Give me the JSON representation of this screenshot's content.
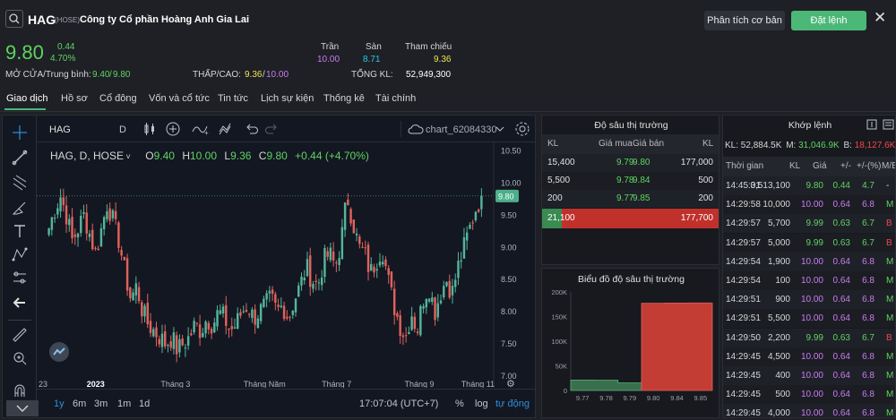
{
  "header": {
    "symbol": "HAG",
    "exchange": "(HOSE)",
    "company": "Công ty Cổ phần Hoàng Anh Gia Lai",
    "btn_analysis": "Phân tích cơ bản",
    "btn_order": "Đặt lệnh",
    "price": "9.80",
    "change": "0.44",
    "change_pct": "4.70%",
    "open_avg_label": "MỞ CỬA/Trung bình:",
    "open": "9.40",
    "avg": "9.80",
    "ceil_label": "Trần",
    "ceil": "10.00",
    "floor_label": "Sàn",
    "floor": "8.71",
    "ref_label": "Tham chiếu",
    "ref": "9.36",
    "lowhigh_label": "THẤP/CAO:",
    "low": "9.36",
    "high": "10.00",
    "vol_label": "TỔNG KL:",
    "vol": "52,949,300"
  },
  "tabs": [
    "Giao dịch",
    "Hồ sơ",
    "Cổ đông",
    "Vốn và cổ tức",
    "Tin tức",
    "Lịch sự kiện",
    "Thống kê",
    "Tài chính"
  ],
  "chart": {
    "symbol_box": "HAG",
    "interval": "D",
    "layout_name": "chart_62084330",
    "legend_title": "HAG, D, HOSE",
    "o_label": "O",
    "o": "9.40",
    "h_label": "H",
    "h": "10.00",
    "l_label": "L",
    "l": "9.36",
    "c_label": "C",
    "c": "9.80",
    "chg": "+0.44 (+4.70%)",
    "last_price_tag": "9.80",
    "time": "17:07:04 (UTC+7)",
    "ranges": [
      "1y",
      "6m",
      "3m",
      "1m",
      "1d"
    ],
    "pct": "%",
    "log": "log",
    "auto": "tự động"
  },
  "chart_data": {
    "type": "candlestick",
    "title": "HAG, D, HOSE",
    "y_ticks": [
      10.5,
      10.0,
      9.5,
      9.0,
      8.5,
      8.0,
      7.5,
      7.0
    ],
    "y_tick_labels": [
      "10.50",
      "10.00",
      "9.50",
      "9.00",
      "8.50",
      "8.00",
      "7.50",
      "7.00"
    ],
    "ylim": [
      6.9,
      10.55
    ],
    "x_tick_labels": [
      "23",
      "2023",
      "Tháng 3",
      "Tháng Năm",
      "Tháng 7",
      "Tháng 9",
      "Tháng 11"
    ],
    "close_path": [
      9.3,
      9.6,
      9.8,
      9.5,
      9.1,
      9.3,
      9.5,
      9.2,
      8.9,
      9.3,
      9.7,
      9.4,
      9.1,
      8.6,
      8.2,
      8.4,
      8.0,
      7.8,
      7.7,
      7.6,
      7.5,
      7.6,
      7.4,
      7.5,
      7.6,
      7.8,
      7.7,
      7.9,
      7.8,
      8.0,
      7.9,
      7.7,
      7.8,
      8.0,
      8.1,
      7.9,
      8.0,
      8.1,
      8.2,
      8.0,
      8.1,
      7.9,
      8.2,
      8.4,
      8.7,
      8.5,
      8.4,
      8.8,
      8.9,
      8.7,
      9.1,
      9.8,
      9.4,
      9.0,
      8.9,
      8.6,
      8.8,
      9.0,
      8.5,
      8.1,
      7.8,
      7.6,
      8.0,
      7.7,
      8.2,
      8.4,
      8.0,
      8.3,
      8.5,
      8.3,
      8.7,
      9.0,
      9.3,
      9.6,
      9.8
    ],
    "last_close": 9.8,
    "x_ticks_at": [
      0.0,
      0.09,
      0.26,
      0.45,
      0.63,
      0.82,
      0.95
    ]
  },
  "depth": {
    "title": "Độ sâu thị trường",
    "headers": [
      "KL",
      "Giá mua",
      "Giá bán",
      "KL"
    ],
    "rows": [
      {
        "bid_vol": "15,400",
        "bid": "9.79",
        "ask": "9.80",
        "ask_vol": "177,000"
      },
      {
        "bid_vol": "5,500",
        "bid": "9.78",
        "ask": "9.84",
        "ask_vol": "500"
      },
      {
        "bid_vol": "200",
        "bid": "9.77",
        "ask": "9.85",
        "ask_vol": "200"
      }
    ],
    "total_bid": "21,100",
    "total_ask": "177,700",
    "bid_fraction": 0.11
  },
  "depth_chart": {
    "title": "Biểu đồ độ sâu thị trường",
    "y_labels": [
      "200K",
      "150K",
      "100K",
      "50K",
      "0"
    ],
    "x_labels": [
      "9.77",
      "9.78",
      "9.79",
      "9.80",
      "9.84",
      "9.85"
    ],
    "bid_cum": [
      21100,
      20900,
      15400
    ],
    "ask_cum": [
      177000,
      177500,
      177700
    ],
    "ymax": 200000
  },
  "matches": {
    "title": "Khớp lệnh",
    "summary_kl_label": "KL:",
    "summary_kl": "52,884.5K",
    "m_label": "M:",
    "m": "31,046.9K",
    "b_label": "B:",
    "b": "18,127.6K",
    "headers": [
      "Thời gian",
      "KL",
      "Giá",
      "+/-",
      "+/-(%)",
      "M/B"
    ],
    "rows": [
      {
        "t": "14:45:01",
        "kl": "3,513,100",
        "p": "9.80",
        "d": "0.44",
        "pct": "4.7",
        "mb": "-",
        "color": "green"
      },
      {
        "t": "14:29:58",
        "kl": "10,000",
        "p": "10.00",
        "d": "0.64",
        "pct": "6.8",
        "mb": "M",
        "color": "purple"
      },
      {
        "t": "14:29:57",
        "kl": "5,700",
        "p": "9.99",
        "d": "0.63",
        "pct": "6.7",
        "mb": "B",
        "color": "green"
      },
      {
        "t": "14:29:57",
        "kl": "5,000",
        "p": "9.99",
        "d": "0.63",
        "pct": "6.7",
        "mb": "B",
        "color": "green"
      },
      {
        "t": "14:29:54",
        "kl": "1,900",
        "p": "10.00",
        "d": "0.64",
        "pct": "6.8",
        "mb": "M",
        "color": "purple"
      },
      {
        "t": "14:29:54",
        "kl": "100",
        "p": "10.00",
        "d": "0.64",
        "pct": "6.8",
        "mb": "M",
        "color": "purple"
      },
      {
        "t": "14:29:51",
        "kl": "900",
        "p": "10.00",
        "d": "0.64",
        "pct": "6.8",
        "mb": "M",
        "color": "purple"
      },
      {
        "t": "14:29:51",
        "kl": "5,500",
        "p": "10.00",
        "d": "0.64",
        "pct": "6.8",
        "mb": "M",
        "color": "purple"
      },
      {
        "t": "14:29:50",
        "kl": "2,200",
        "p": "9.99",
        "d": "0.63",
        "pct": "6.7",
        "mb": "B",
        "color": "green"
      },
      {
        "t": "14:29:45",
        "kl": "4,500",
        "p": "10.00",
        "d": "0.64",
        "pct": "6.8",
        "mb": "M",
        "color": "purple"
      },
      {
        "t": "14:29:45",
        "kl": "400",
        "p": "10.00",
        "d": "0.64",
        "pct": "6.8",
        "mb": "M",
        "color": "purple"
      },
      {
        "t": "14:29:45",
        "kl": "500",
        "p": "10.00",
        "d": "0.64",
        "pct": "6.8",
        "mb": "M",
        "color": "purple"
      },
      {
        "t": "14:29:45",
        "kl": "4,000",
        "p": "10.00",
        "d": "0.64",
        "pct": "6.8",
        "mb": "M",
        "color": "purple"
      }
    ]
  },
  "colors": {
    "up": "#5fd35f",
    "down": "#f04848",
    "ceil": "#c97cf0",
    "floor": "#29c6e8",
    "ref": "#f3e34b",
    "accent": "#4cb877"
  }
}
